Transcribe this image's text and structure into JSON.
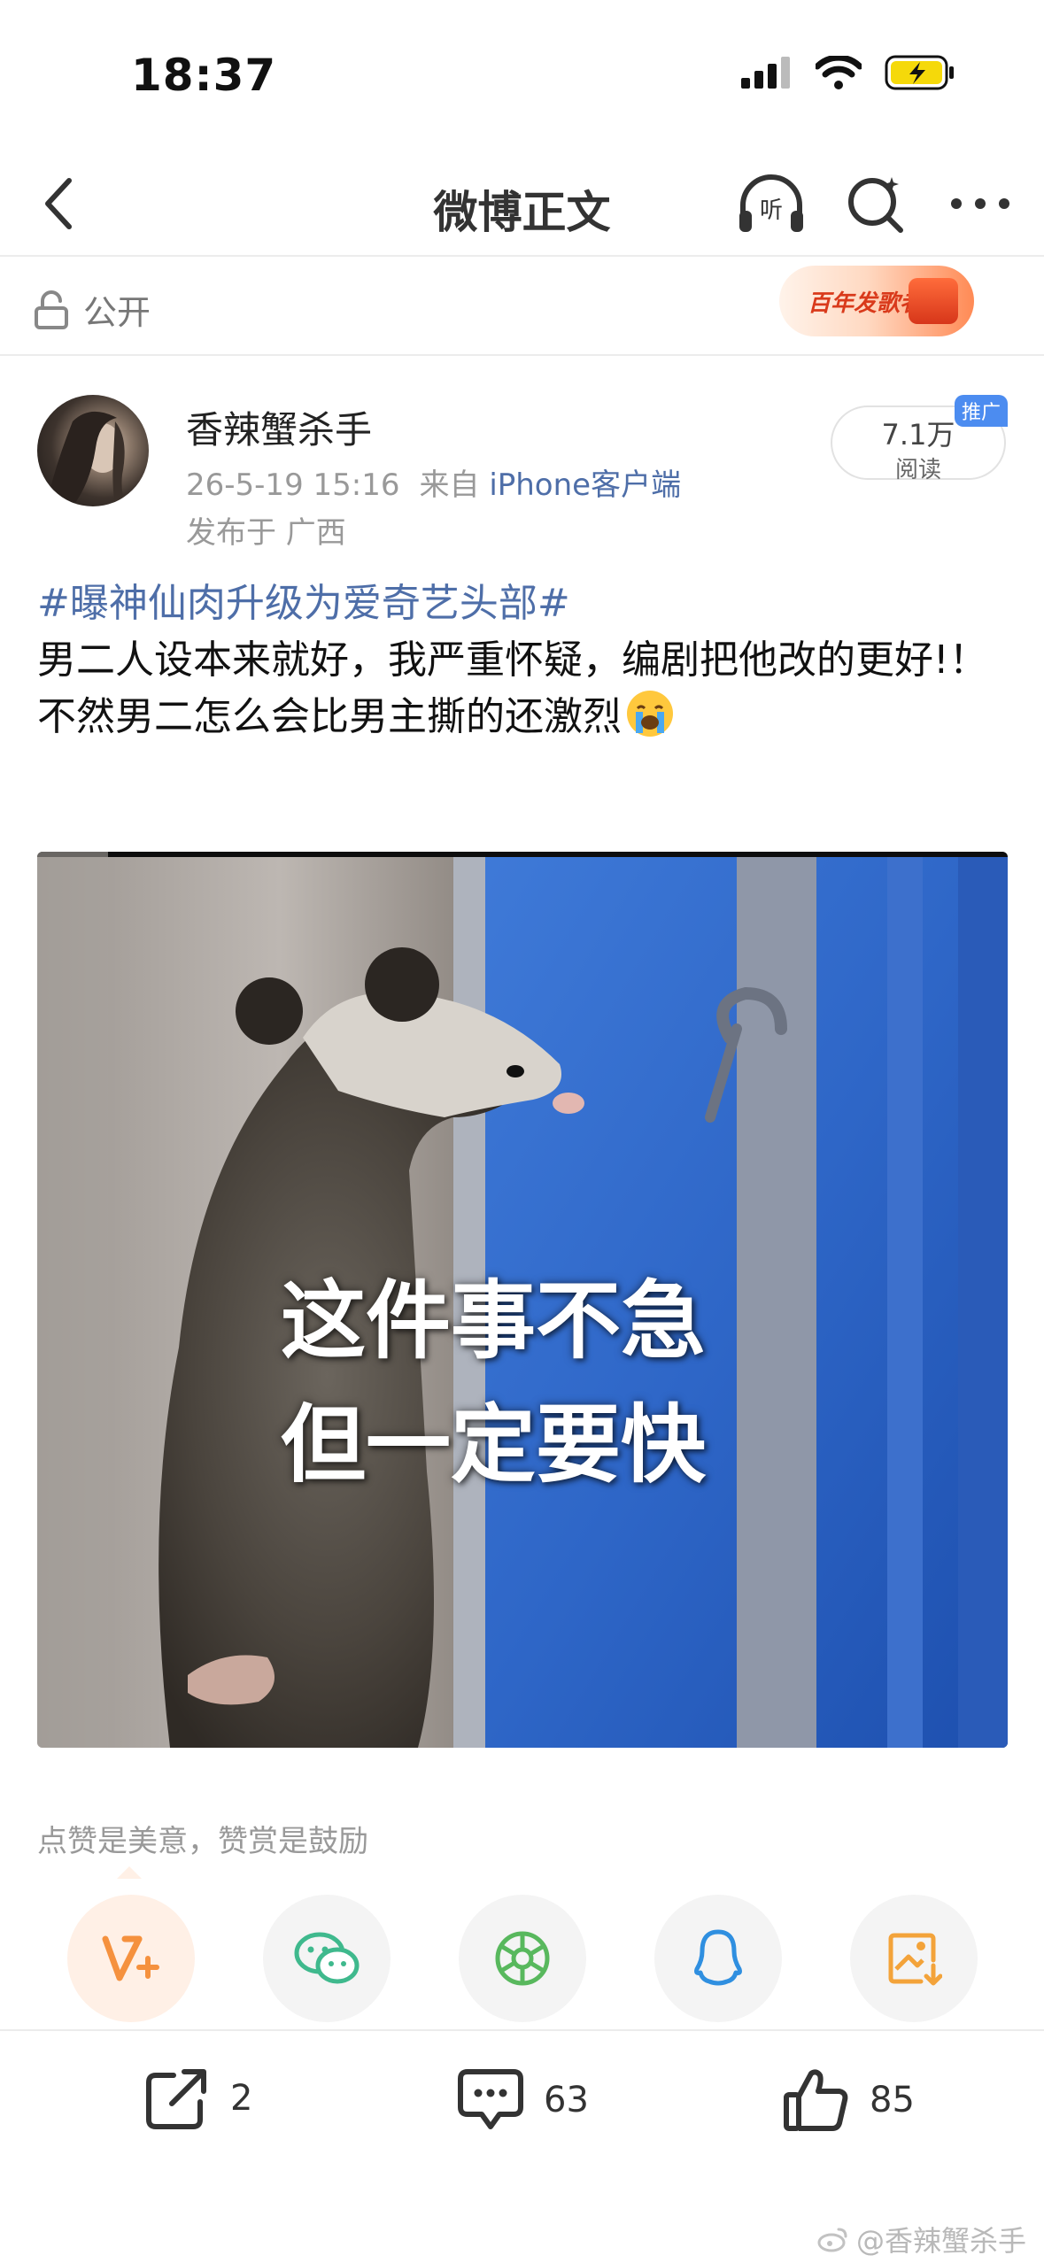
{
  "status_bar": {
    "time": "18:37"
  },
  "nav": {
    "title": "微博正文",
    "listen_label": "听"
  },
  "visibility": {
    "label": "公开"
  },
  "promo_banner": {
    "text": "百年发歌者"
  },
  "post": {
    "author": "香辣蟹杀手",
    "date": "26-5-19 15:16",
    "source_prefix": "来自",
    "source_client": "iPhone客户端",
    "location": "发布于 广西",
    "read_count": "7.1万",
    "read_label": "阅读",
    "promo_tag": "推广",
    "hashtag": "#曝神仙肉升级为爱奇艺头部#",
    "text_lines": [
      "男二人设本来就好，我严重怀疑，编剧把他改的更好!！",
      "不然男二怎么会比男主撕的还激烈"
    ],
    "emoji": "loudly-crying-face",
    "image": {
      "caption_line1": "这件事不急",
      "caption_line2": "但一定要快"
    }
  },
  "appreciation": {
    "hint": "点赞是美意，赞赏是鼓励",
    "share_targets": [
      "reward",
      "wechat",
      "moments",
      "qq",
      "save-image"
    ]
  },
  "actions": {
    "repost_count": "2",
    "comment_count": "63",
    "like_count": "85"
  },
  "watermark": "@香辣蟹杀手",
  "colors": {
    "link_blue": "#4e6ea8",
    "reward_orange": "#f5913e",
    "wechat_green": "#3fb98d",
    "moments_green": "#58b85d",
    "qq_blue": "#2f8fe0",
    "save_orange": "#f3a33a"
  }
}
